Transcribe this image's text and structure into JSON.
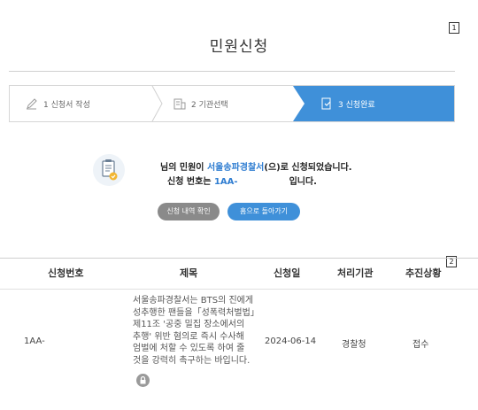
{
  "markers": {
    "m1": "1",
    "m2": "2"
  },
  "page_title": "민원신청",
  "steps": [
    {
      "label": "1 신청서 작성",
      "icon": "pencil-icon"
    },
    {
      "label": "2 기관선택",
      "icon": "building-icon"
    },
    {
      "label": "3 신청완료",
      "icon": "check-document-icon"
    }
  ],
  "result": {
    "line1_prefix": "님의 민원이 ",
    "line1_agency": "서울송파경찰서",
    "line1_suffix": "(으)로 신청되었습니다.",
    "line2_prefix": "신청 번호는 ",
    "line2_number": "1AA-",
    "line2_suffix": "입니다.",
    "btn_check": "신청 내역 확인",
    "btn_home": "홈으로 돌아가기"
  },
  "table": {
    "headers": [
      "신청번호",
      "제목",
      "신청일",
      "처리기관",
      "추진상황"
    ],
    "row": {
      "number": "1AA-",
      "subject": "서울송파경찰서는 BTS의 진에게 성추행한 팬들을「성폭력처벌법」제11조 '공중 밀집 장소에서의 추행' 위반 혐의로 즉시 수사해 엄벌에 처할 수 있도록 하여 줄 것을 강력히 촉구하는 바입니다.",
      "date": "2024-06-14",
      "agency": "경찰청",
      "status": "접수"
    }
  },
  "colors": {
    "accent": "#3f90d9",
    "gray_button": "#8a8a8a"
  }
}
